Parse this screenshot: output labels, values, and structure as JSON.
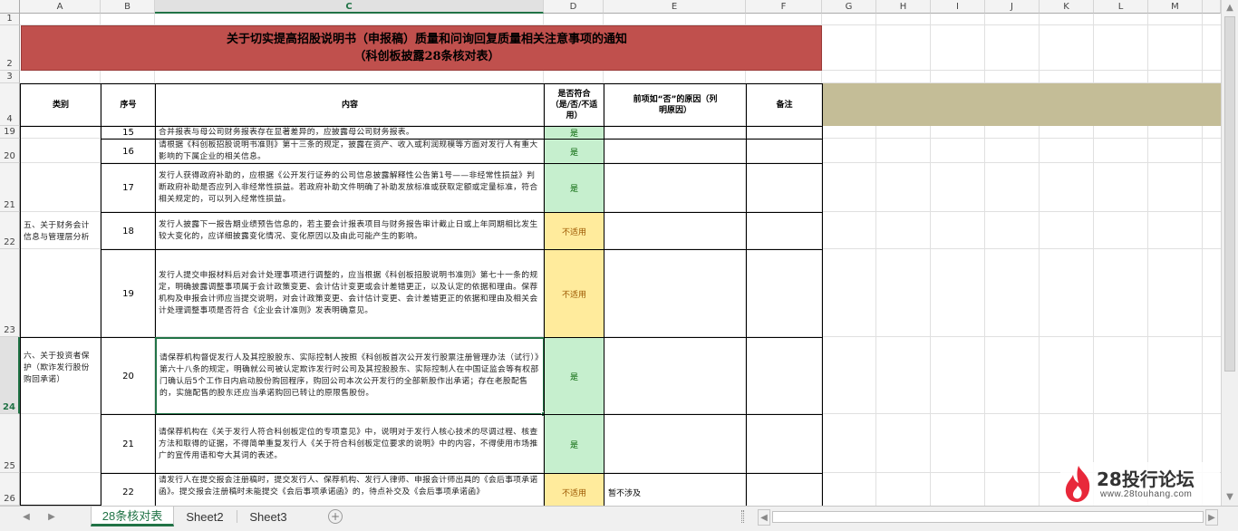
{
  "columns": [
    "A",
    "B",
    "C",
    "D",
    "E",
    "F",
    "G",
    "H",
    "I",
    "J",
    "K",
    "L",
    "M"
  ],
  "rows": [
    "1",
    "2",
    "3",
    "4",
    "19",
    "20",
    "21",
    "22",
    "23",
    "24",
    "25",
    "26"
  ],
  "title": {
    "line1": "关于切实提高招股说明书（申报稿）质量和问询回复质量相关注意事项的通知",
    "line2": "（科创板披露28条核对表）"
  },
  "header": {
    "category": "类别",
    "seq": "序号",
    "content": "内容",
    "compliance": "是否符合（是/否/不适用）",
    "reason": "前项如“否”的原因（列明原因）",
    "note": "备注"
  },
  "categories": {
    "cat5": "五、关于财务会计信息与管理层分析",
    "cat6": "六、关于投资者保护（欺诈发行股份购回承诺）"
  },
  "table_rows": [
    {
      "seq": "15",
      "content": "合并报表与母公司财务报表存在显著差异的，应披露母公司财务报表。",
      "status": "是",
      "reason": ""
    },
    {
      "seq": "16",
      "content": "请根据《科创板招股说明书准则》第十三条的规定，披露在资产、收入或利润规模等方面对发行人有重大影响的下属企业的相关信息。",
      "status": "是",
      "reason": ""
    },
    {
      "seq": "17",
      "content": "发行人获得政府补助的，应根据《公开发行证券的公司信息披露解释性公告第1号——非经常性损益》判断政府补助是否应列入非经常性损益。若政府补助文件明确了补助发放标准或获取定额或定量标准，符合相关规定的，可以列入经常性损益。",
      "status": "是",
      "reason": ""
    },
    {
      "seq": "18",
      "content": "发行人披露下一报告期业绩预告信息的，若主要会计报表项目与财务报告审计截止日或上年同期相比发生较大变化的，应详细披露变化情况、变化原因以及由此可能产生的影响。",
      "status": "不适用",
      "reason": ""
    },
    {
      "seq": "19",
      "content": "发行人提交申报材料后对会计处理事项进行调整的，应当根据《科创板招股说明书准则》第七十一条的规定，明确披露调整事项属于会计政策变更、会计估计变更或会计差错更正，以及认定的依据和理由。保荐机构及申报会计师应当提交说明，对会计政策变更、会计估计变更、会计差错更正的依据和理由及相关会计处理调整事项是否符合《企业会计准则》发表明确意见。",
      "status": "不适用",
      "reason": ""
    },
    {
      "seq": "20",
      "content": "请保荐机构督促发行人及其控股股东、实际控制人按照《科创板首次公开发行股票注册管理办法（试行）》第六十八条的规定，明确就公司被认定欺诈发行时公司及其控股股东、实际控制人在中国证监会等有权部门确认后5个工作日内启动股份购回程序，购回公司本次公开发行的全部新股作出承诺；存在老股配售的，实施配售的股东还应当承诺购回已转让的原限售股份。",
      "status": "是",
      "reason": ""
    },
    {
      "seq": "21",
      "content": "请保荐机构在《关于发行人符合科创板定位的专项意见》中，说明对于发行人核心技术的尽调过程、核查方法和取得的证据，不得简单重复发行人《关于符合科创板定位要求的说明》中的内容，不得使用市场推广的宣传用语和夸大其词的表述。",
      "status": "是",
      "reason": ""
    },
    {
      "seq": "22",
      "content": "请发行人在提交报会注册稿时，提交发行人、保荐机构、发行人律师、申报会计师出具的《会后事项承诺函》。提交报会注册稿时未能提交《会后事项承诺函》的，待点补交及《会后事项承诺函》",
      "status": "不适用",
      "reason": "暂不涉及"
    }
  ],
  "tabs": [
    "28条核对表",
    "Sheet2",
    "Sheet3"
  ],
  "watermark": {
    "brand": "28投行论坛",
    "url": "www.28touhang.com"
  },
  "colors": {
    "title_band": "#c0504d",
    "grey_band": "#c4bd97",
    "yes_fill": "#c6efce",
    "na_fill": "#ffeb9c",
    "accent": "#217346"
  }
}
